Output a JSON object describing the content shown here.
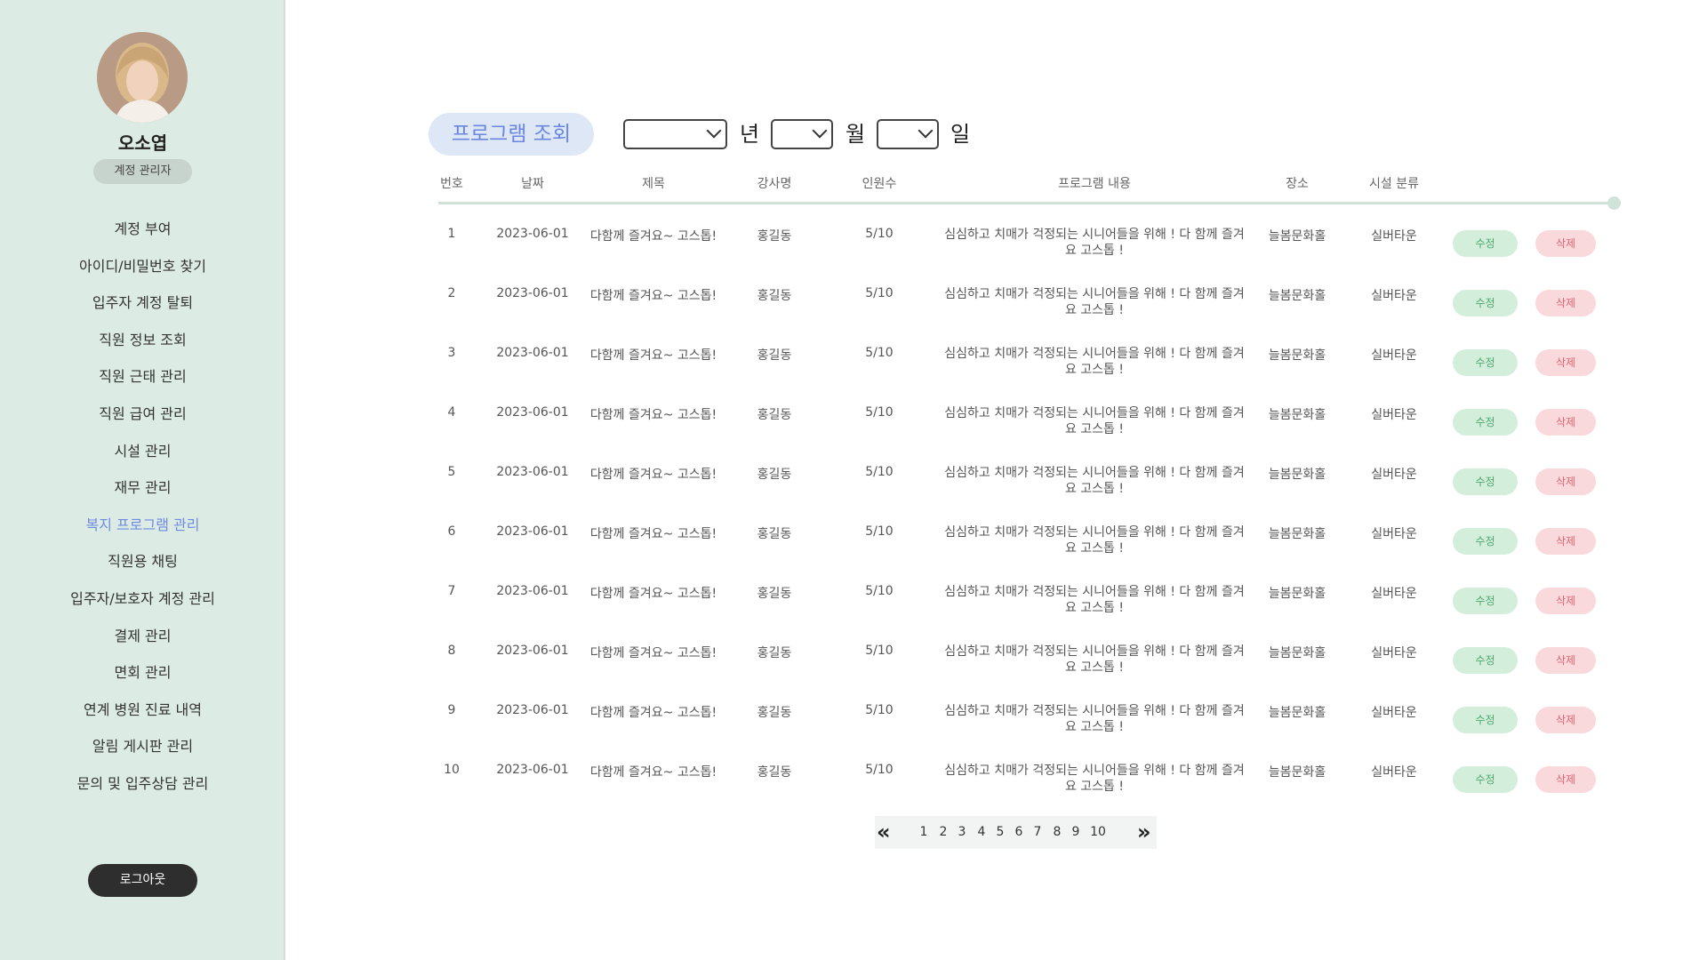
{
  "sidebar": {
    "user_name": "오소엽",
    "role": "계정 관리자",
    "menu": [
      {
        "label": "계정 부여"
      },
      {
        "label": "아이디/비밀번호 찾기"
      },
      {
        "label": "입주자 계정 탈퇴"
      },
      {
        "label": "직원 정보 조회"
      },
      {
        "label": "직원 근태 관리"
      },
      {
        "label": "직원 급여 관리"
      },
      {
        "label": "시설 관리"
      },
      {
        "label": "재무 관리"
      },
      {
        "label": "복지 프로그램 관리",
        "active": true
      },
      {
        "label": "직원용 채팅"
      },
      {
        "label": "입주자/보호자 계정 관리"
      },
      {
        "label": "결제 관리"
      },
      {
        "label": "면회 관리"
      },
      {
        "label": "연계 병원 진료 내역"
      },
      {
        "label": "알림 게시판 관리"
      },
      {
        "label": "문의 및 입주상담 관리"
      }
    ],
    "logout_label": "로그아웃"
  },
  "main": {
    "title": "프로그램 조회",
    "date_filter": {
      "year_value": "",
      "year_label": "년",
      "month_value": "",
      "month_label": "월",
      "day_value": "",
      "day_label": "일"
    },
    "columns": [
      "번호",
      "날짜",
      "제목",
      "강사명",
      "인원수",
      "프로그램 내용",
      "장소",
      "시설 분류"
    ],
    "rows": [
      {
        "no": "1",
        "date": "2023-06-01",
        "title": "다함께 즐겨요~ 고스톱!",
        "instructor": "홍길동",
        "count": "5/10",
        "content": "심심하고 치매가 걱정되는 시니어들을 위해 ! 다 함께 즐겨요 고스톱 !",
        "place": "늘봄문화홀",
        "category": "실버타운",
        "edit": "수정",
        "delete": "삭제"
      },
      {
        "no": "2",
        "date": "2023-06-01",
        "title": "다함께 즐겨요~ 고스톱!",
        "instructor": "홍길동",
        "count": "5/10",
        "content": "심심하고 치매가 걱정되는 시니어들을 위해 ! 다 함께 즐겨요 고스톱 !",
        "place": "늘봄문화홀",
        "category": "실버타운",
        "edit": "수정",
        "delete": "삭제"
      },
      {
        "no": "3",
        "date": "2023-06-01",
        "title": "다함께 즐겨요~ 고스톱!",
        "instructor": "홍길동",
        "count": "5/10",
        "content": "심심하고 치매가 걱정되는 시니어들을 위해 ! 다 함께 즐겨요 고스톱 !",
        "place": "늘봄문화홀",
        "category": "실버타운",
        "edit": "수정",
        "delete": "삭제"
      },
      {
        "no": "4",
        "date": "2023-06-01",
        "title": "다함께 즐겨요~ 고스톱!",
        "instructor": "홍길동",
        "count": "5/10",
        "content": "심심하고 치매가 걱정되는 시니어들을 위해 ! 다 함께 즐겨요 고스톱 !",
        "place": "늘봄문화홀",
        "category": "실버타운",
        "edit": "수정",
        "delete": "삭제"
      },
      {
        "no": "5",
        "date": "2023-06-01",
        "title": "다함께 즐겨요~ 고스톱!",
        "instructor": "홍길동",
        "count": "5/10",
        "content": "심심하고 치매가 걱정되는 시니어들을 위해 ! 다 함께 즐겨요 고스톱 !",
        "place": "늘봄문화홀",
        "category": "실버타운",
        "edit": "수정",
        "delete": "삭제"
      },
      {
        "no": "6",
        "date": "2023-06-01",
        "title": "다함께 즐겨요~ 고스톱!",
        "instructor": "홍길동",
        "count": "5/10",
        "content": "심심하고 치매가 걱정되는 시니어들을 위해 ! 다 함께 즐겨요 고스톱 !",
        "place": "늘봄문화홀",
        "category": "실버타운",
        "edit": "수정",
        "delete": "삭제"
      },
      {
        "no": "7",
        "date": "2023-06-01",
        "title": "다함께 즐겨요~ 고스톱!",
        "instructor": "홍길동",
        "count": "5/10",
        "content": "심심하고 치매가 걱정되는 시니어들을 위해 ! 다 함께 즐겨요 고스톱 !",
        "place": "늘봄문화홀",
        "category": "실버타운",
        "edit": "수정",
        "delete": "삭제"
      },
      {
        "no": "8",
        "date": "2023-06-01",
        "title": "다함께 즐겨요~ 고스톱!",
        "instructor": "홍길동",
        "count": "5/10",
        "content": "심심하고 치매가 걱정되는 시니어들을 위해 ! 다 함께 즐겨요 고스톱 !",
        "place": "늘봄문화홀",
        "category": "실버타운",
        "edit": "수정",
        "delete": "삭제"
      },
      {
        "no": "9",
        "date": "2023-06-01",
        "title": "다함께 즐겨요~ 고스톱!",
        "instructor": "홍길동",
        "count": "5/10",
        "content": "심심하고 치매가 걱정되는 시니어들을 위해 ! 다 함께 즐겨요 고스톱 !",
        "place": "늘봄문화홀",
        "category": "실버타운",
        "edit": "수정",
        "delete": "삭제"
      },
      {
        "no": "10",
        "date": "2023-06-01",
        "title": "다함께 즐겨요~ 고스톱!",
        "instructor": "홍길동",
        "count": "5/10",
        "content": "심심하고 치매가 걱정되는 시니어들을 위해 ! 다 함께 즐겨요 고스톱 !",
        "place": "늘봄문화홀",
        "category": "실버타운",
        "edit": "수정",
        "delete": "삭제"
      }
    ],
    "pagination": {
      "prev": "«",
      "next": "»",
      "pages": [
        "1",
        "2",
        "3",
        "4",
        "5",
        "6",
        "7",
        "8",
        "9",
        "10"
      ]
    }
  },
  "colors": {
    "sidebar_bg": "#dcebe3",
    "accent": "#6a86e0",
    "edit_bg": "#d3efdc",
    "delete_bg": "#fad9dc"
  }
}
